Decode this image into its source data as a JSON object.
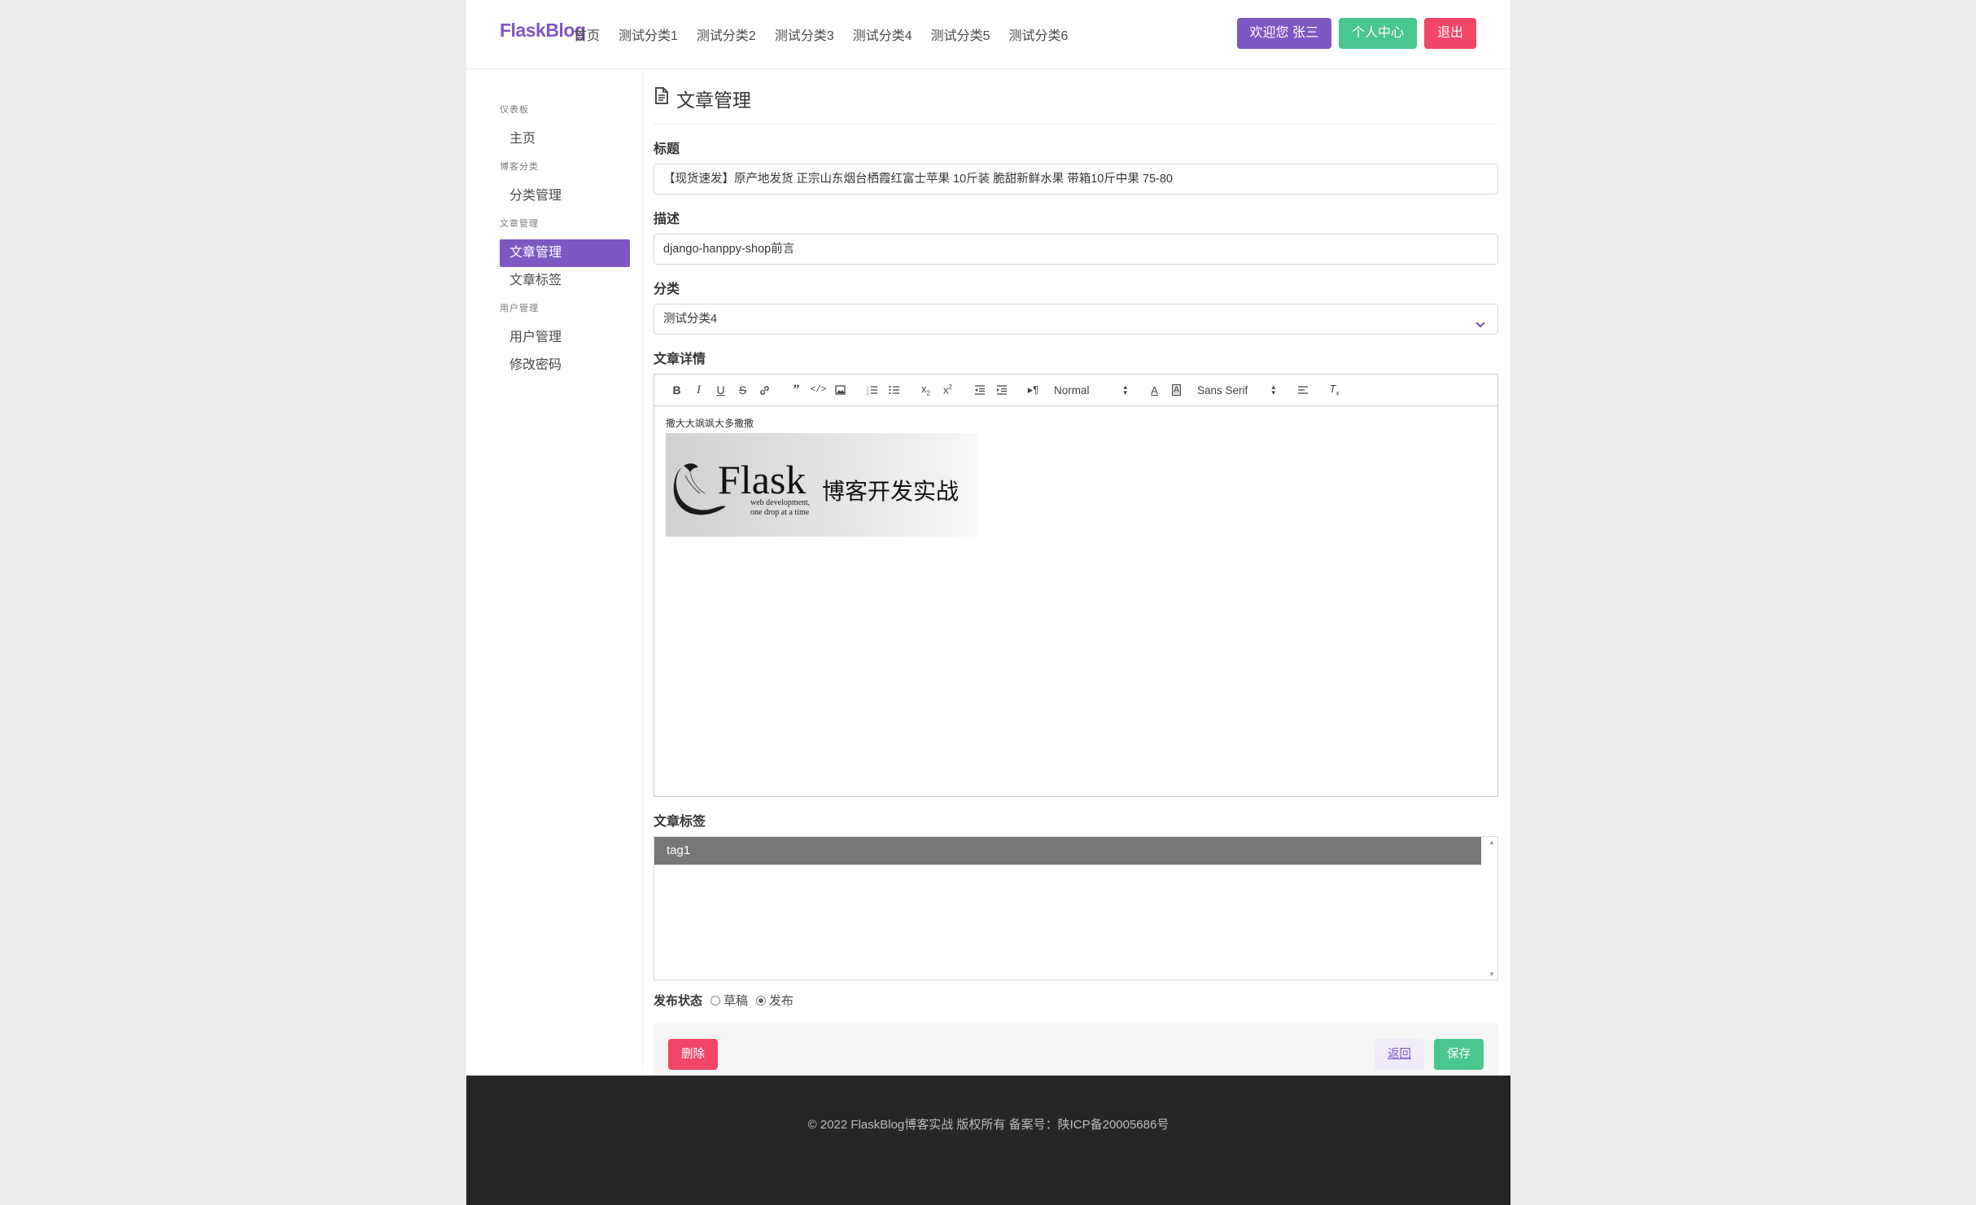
{
  "navbar": {
    "brand": "FlaskBlog",
    "links": [
      "首页",
      "测试分类1",
      "测试分类2",
      "测试分类3",
      "测试分类4",
      "测试分类5",
      "测试分类6"
    ],
    "welcome": "欢迎您 张三",
    "profile": "个人中心",
    "logout": "退出"
  },
  "sidebar": {
    "groups": [
      {
        "label": "仪表板",
        "items": [
          "主页"
        ]
      },
      {
        "label": "博客分类",
        "items": [
          "分类管理"
        ]
      },
      {
        "label": "文章管理",
        "items": [
          "文章管理",
          "文章标签"
        ]
      },
      {
        "label": "用户管理",
        "items": [
          "用户管理",
          "修改密码"
        ]
      }
    ],
    "active_item": "文章管理"
  },
  "main": {
    "page_title": "文章管理",
    "title_label": "标题",
    "title_value": "【现货速发】原产地发货 正宗山东烟台栖霞红富士苹果 10斤装 脆甜新鲜水果 带箱10斤中果 75-80",
    "desc_label": "描述",
    "desc_value": "django-hanppy-shop前言",
    "category_label": "分类",
    "category_value": "测试分类4",
    "detail_label": "文章详情",
    "editor": {
      "header_select": "Normal",
      "font_select": "Sans Serif",
      "body_text": "撒大大飒飒大多撒撒",
      "image_word": "Flask",
      "image_tagline_1": "web development,",
      "image_tagline_2": "one drop at a time",
      "image_caption": "博客开发实战"
    },
    "tags_label": "文章标签",
    "tags": [
      "tag1"
    ],
    "status_label": "发布状态",
    "status_options": [
      "草稿",
      "发布"
    ],
    "status_selected": "发布",
    "delete_button": "删除",
    "back_button": "返回",
    "save_button": "保存"
  },
  "footer": {
    "text": "© 2022 FlaskBlog博客实战 版权所有 备案号：陕ICP备20005686号"
  },
  "colors": {
    "accent": "#7e57c2",
    "success": "#48c78e",
    "danger": "#f14668",
    "footer_bg": "#262626"
  }
}
